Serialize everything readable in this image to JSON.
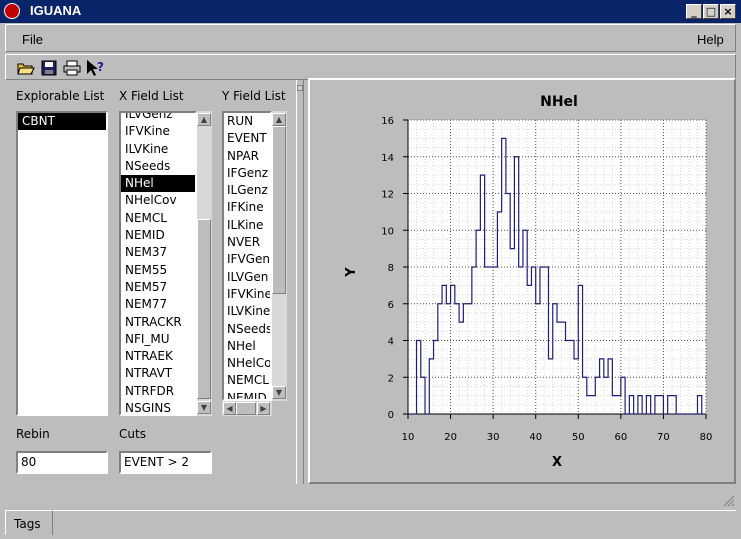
{
  "window": {
    "title": "IGUANA"
  },
  "menu": {
    "file": "File",
    "help": "Help"
  },
  "toolbar": {
    "icons": [
      "open-icon",
      "save-icon",
      "print-icon",
      "whats-this-icon"
    ]
  },
  "labels": {
    "explorable": "Explorable List",
    "xfield": "X Field List",
    "yfield": "Y Field List",
    "rebin": "Rebin",
    "cuts": "Cuts"
  },
  "explorable_items": [
    "CBNT"
  ],
  "xfield_items": [
    "ILVGenz",
    "IFVKine",
    "ILVKine",
    "NSeeds",
    "NHel",
    "NHelCov",
    "NEMCL",
    "NEMID",
    "NEM37",
    "NEM55",
    "NEM57",
    "NEM77",
    "NTRACKR",
    "NFI_MU",
    "NTRAEK",
    "NTRAVT",
    "NTRFDR",
    "NSGINS"
  ],
  "xfield_selected": "NHel",
  "yfield_items": [
    "RUN",
    "EVENT",
    "NPAR",
    "IFGenz",
    "ILGenz",
    "IFKine",
    "ILKine",
    "NVER",
    "IFVGenz",
    "ILVGenz",
    "IFVKine",
    "ILVKine",
    "NSeeds",
    "NHel",
    "NHelCov",
    "NEMCL",
    "NEMID"
  ],
  "yfield_display": [
    "RUN",
    "EVENT",
    "NPAR",
    "IFGenz",
    "ILGenz",
    "IFKine",
    "ILKine",
    "NVER",
    "IFVGen",
    "ILVGen",
    "IFVKine",
    "ILVKine",
    "NSeeds",
    "NHel",
    "NHelCo",
    "NEMCL",
    "NEMID"
  ],
  "rebin_value": "80",
  "cuts_value": "EVENT > 2",
  "tabs": [
    "Tags"
  ],
  "chart_data": {
    "type": "line",
    "title": "NHel",
    "xlabel": "X",
    "ylabel": "Y",
    "xlim": [
      10,
      80
    ],
    "ylim": [
      0,
      16
    ],
    "xticks": [
      10,
      20,
      30,
      40,
      50,
      60,
      70,
      80
    ],
    "yticks": [
      0,
      2,
      4,
      6,
      8,
      10,
      12,
      14,
      16
    ],
    "grid": true,
    "series_color": "#1e1e78",
    "x": [
      11,
      12,
      13,
      14,
      15,
      16,
      17,
      18,
      19,
      20,
      21,
      22,
      23,
      24,
      25,
      26,
      27,
      28,
      29,
      30,
      31,
      32,
      33,
      34,
      35,
      36,
      37,
      38,
      39,
      40,
      41,
      42,
      43,
      44,
      45,
      46,
      47,
      48,
      49,
      50,
      51,
      52,
      53,
      54,
      55,
      56,
      57,
      58,
      59,
      60,
      61,
      62,
      63,
      64,
      65,
      66,
      67,
      68,
      69,
      70,
      71,
      72,
      73,
      74,
      75,
      76,
      77,
      78,
      79
    ],
    "values": [
      0,
      4,
      2,
      0,
      3,
      4,
      6,
      7,
      6,
      7,
      6,
      5,
      6,
      6,
      8,
      10,
      13,
      8,
      8,
      8,
      11,
      15,
      12,
      9,
      14,
      8,
      10,
      7,
      8,
      6,
      8,
      8,
      3,
      6,
      5,
      5,
      4,
      4,
      3,
      7,
      2,
      1,
      1,
      2,
      3,
      2,
      3,
      1,
      1,
      2,
      0,
      1,
      0,
      1,
      0,
      1,
      0,
      1,
      1,
      0,
      1,
      1,
      0,
      0,
      0,
      0,
      0,
      1,
      0
    ]
  }
}
